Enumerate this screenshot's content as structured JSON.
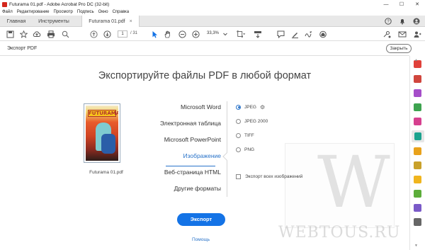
{
  "window": {
    "title": "Futurama 01.pdf - Adobe Acrobat Pro DC (32-bit)",
    "minimize": "—",
    "maximize": "☐",
    "close": "✕"
  },
  "menu": [
    "Файл",
    "Редактирование",
    "Просмотр",
    "Подпись",
    "Окно",
    "Справка"
  ],
  "tabs": {
    "home": "Главная",
    "tools": "Инструменты",
    "document": "Futurama 01.pdf",
    "close": "×"
  },
  "toolbar": {
    "current_page": "1",
    "total_pages": "/ 31",
    "zoom": "33,3%"
  },
  "panel": {
    "title": "Экспорт PDF",
    "close_button": "Закрыть"
  },
  "main": {
    "heading": "Экспортируйте файлы PDF в любой формат",
    "thumbnail_label": "Futurama 01.pdf",
    "thumbnail_logo": "FUTURAMA",
    "formats": [
      "Microsoft Word",
      "Электронная таблица",
      "Microsoft PowerPoint",
      "Изображение",
      "Веб-страница HTML",
      "Другие форматы"
    ],
    "active_format": "Изображение",
    "options": [
      {
        "label": "JPEG",
        "selected": true
      },
      {
        "label": "JPEG 2000",
        "selected": false
      },
      {
        "label": "TIFF",
        "selected": false
      },
      {
        "label": "PNG",
        "selected": false
      }
    ],
    "checkbox_label": "Экспорт всех изображений",
    "export_button": "Экспорт",
    "help_link": "Помощь"
  },
  "watermark": {
    "letter": "W",
    "text": "WEBTOUS.RU"
  },
  "colors": {
    "accent": "#1473e6",
    "link": "#2973c9"
  },
  "rail_icons": [
    "pdf-icon",
    "create-icon",
    "combine-icon",
    "organize-icon",
    "edit-icon",
    "export-icon",
    "comment-icon",
    "fill-sign-icon",
    "send-icon",
    "scan-icon",
    "protect-icon",
    "more-icon"
  ]
}
